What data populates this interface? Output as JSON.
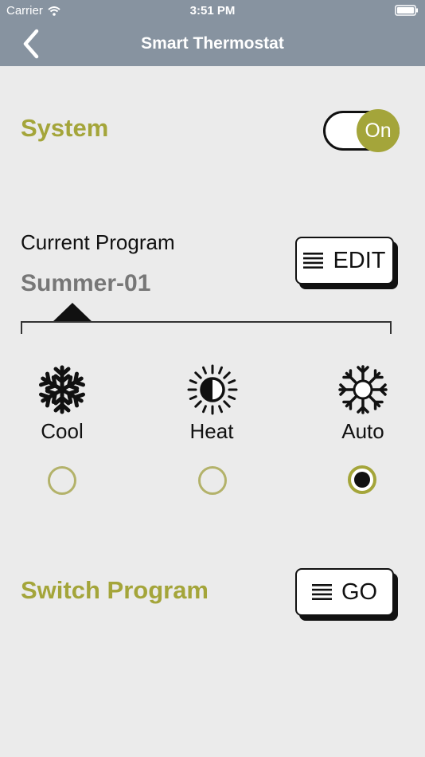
{
  "status_bar": {
    "carrier": "Carrier",
    "time": "3:51 PM"
  },
  "nav": {
    "title": "Smart Thermostat",
    "back_icon": "chevron-left-icon"
  },
  "system": {
    "label": "System",
    "toggle_label": "On",
    "is_on": true
  },
  "program": {
    "label": "Current Program",
    "name": "Summer-01",
    "edit_label": "EDIT"
  },
  "modes": [
    {
      "label": "Cool",
      "icon": "snowflake-icon",
      "selected": false
    },
    {
      "label": "Heat",
      "icon": "sun-icon",
      "selected": false
    },
    {
      "label": "Auto",
      "icon": "snow-sun-icon",
      "selected": true
    }
  ],
  "switch_program": {
    "label": "Switch Program",
    "go_label": "GO"
  },
  "colors": {
    "accent": "#a4a53a",
    "nav_bg": "#8793a0",
    "background": "#ebebeb"
  }
}
